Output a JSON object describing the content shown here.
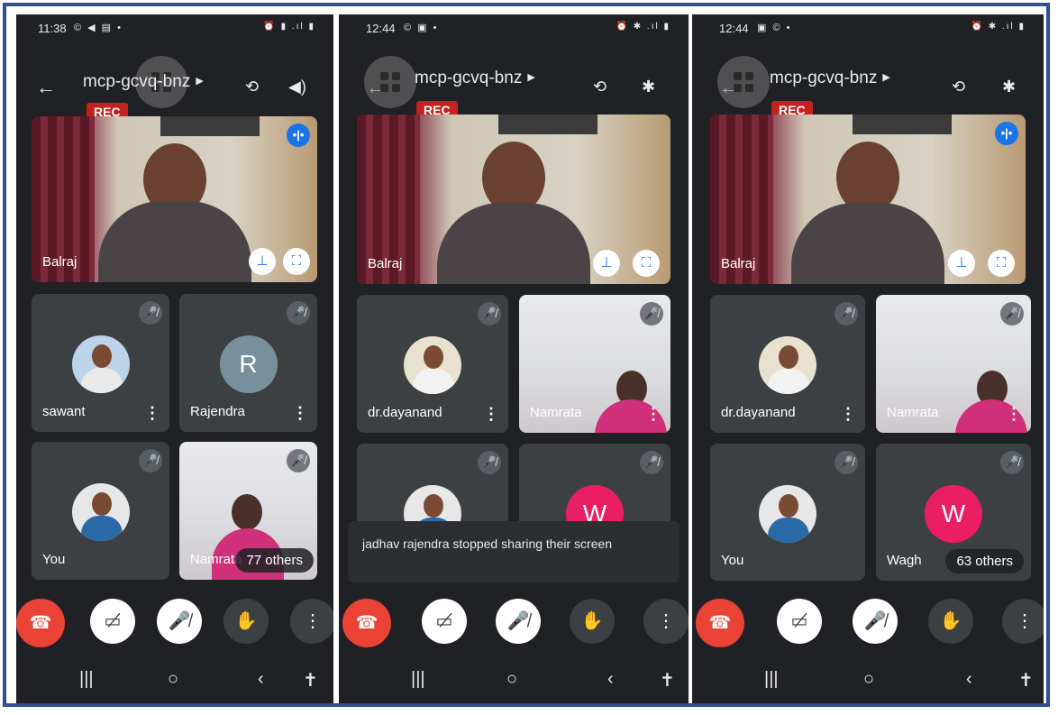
{
  "colors": {
    "border": "#2e4f94",
    "background": "#202124",
    "tile": "#3c4043",
    "rec": "#c5221f",
    "end_call": "#ea4335",
    "accent_blue": "#1a73e8",
    "avatar_r": "#78909c",
    "avatar_w": "#e91e63"
  },
  "screens": [
    {
      "status_time": "11:38",
      "meeting_code": "mcp-gcvq-bnz",
      "rec_label": "REC",
      "main_speaker": "Balraj",
      "tiles": [
        {
          "name": "sawant",
          "kind": "photo"
        },
        {
          "name": "Rajendra",
          "kind": "letter",
          "letter": "R"
        },
        {
          "name": "You",
          "kind": "photo"
        },
        {
          "name": "Namrata",
          "kind": "video",
          "others": "77 others"
        }
      ]
    },
    {
      "status_time": "12:44",
      "meeting_code": "mcp-gcvq-bnz",
      "rec_label": "REC",
      "main_speaker": "Balraj",
      "tiles": [
        {
          "name": "dr.dayanand",
          "kind": "photo"
        },
        {
          "name": "Namrata",
          "kind": "video"
        },
        {
          "kind": "photo"
        },
        {
          "kind": "letter",
          "letter": "W"
        }
      ],
      "toast": "jadhav rajendra stopped sharing their screen"
    },
    {
      "status_time": "12:44",
      "meeting_code": "mcp-gcvq-bnz",
      "rec_label": "REC",
      "main_speaker": "Balraj",
      "tiles": [
        {
          "name": "dr.dayanand",
          "kind": "photo"
        },
        {
          "name": "Namrata",
          "kind": "video"
        },
        {
          "name": "You",
          "kind": "photo"
        },
        {
          "name": "Wagh",
          "kind": "letter",
          "letter": "W",
          "others": "63 others"
        }
      ]
    }
  ]
}
